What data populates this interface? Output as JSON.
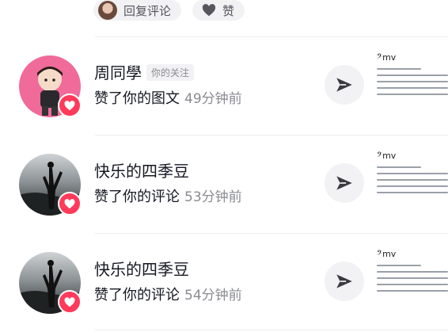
{
  "top_actions": {
    "reply_label": "回复评论",
    "like_label": "赞"
  },
  "colors": {
    "accent": "#ff3a5a",
    "text_primary": "#161823",
    "text_secondary": "#8a8b91"
  },
  "notifications": [
    {
      "user_name": "周同學",
      "tag": "你的关注",
      "action": "赞了你的图文",
      "time": "49分钟前",
      "thumb_title": "𝄢mv"
    },
    {
      "user_name": "快乐的四季豆",
      "action": "赞了你的评论",
      "time": "53分钟前",
      "thumb_title": "𝄢mv"
    },
    {
      "user_name": "快乐的四季豆",
      "action": "赞了你的评论",
      "time": "54分钟前",
      "thumb_title": "𝄢mv"
    }
  ]
}
